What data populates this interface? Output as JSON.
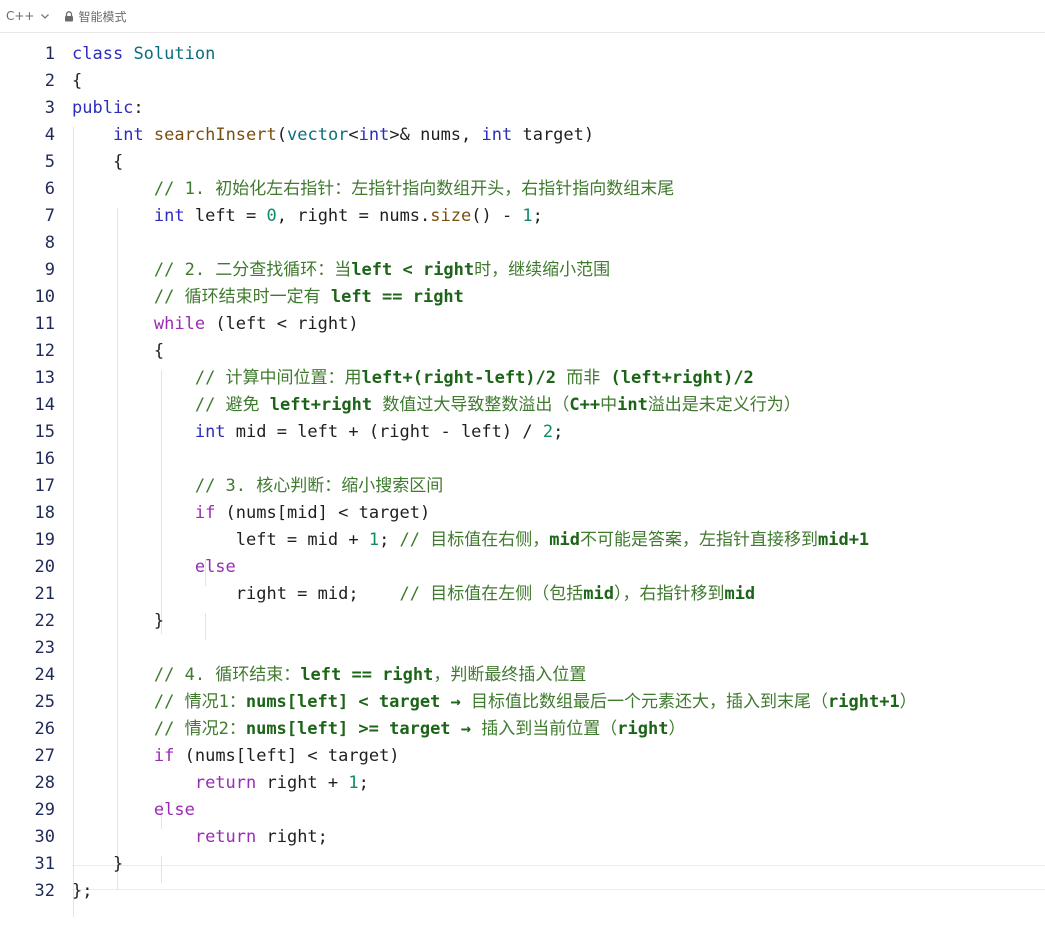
{
  "toolbar": {
    "language": "C++",
    "mode": "智能模式",
    "icons": [
      "chevron-down-icon",
      "lock-icon"
    ]
  },
  "code": {
    "lines": [
      {
        "n": "1",
        "t": [
          {
            "s": "kw",
            "v": "class"
          },
          {
            "s": "",
            "v": " "
          },
          {
            "s": "ty",
            "v": "Solution"
          }
        ]
      },
      {
        "n": "2",
        "t": [
          {
            "s": "",
            "v": "{"
          }
        ]
      },
      {
        "n": "3",
        "t": [
          {
            "s": "kw",
            "v": "public"
          },
          {
            "s": "",
            "v": ":"
          }
        ]
      },
      {
        "n": "4",
        "t": [
          {
            "s": "",
            "v": "    "
          },
          {
            "s": "kw",
            "v": "int"
          },
          {
            "s": "",
            "v": " "
          },
          {
            "s": "fn",
            "v": "searchInsert"
          },
          {
            "s": "",
            "v": "("
          },
          {
            "s": "ty",
            "v": "vector"
          },
          {
            "s": "",
            "v": "<"
          },
          {
            "s": "kw",
            "v": "int"
          },
          {
            "s": "",
            "v": ">& nums, "
          },
          {
            "s": "kw",
            "v": "int"
          },
          {
            "s": "",
            "v": " target)"
          }
        ]
      },
      {
        "n": "5",
        "t": [
          {
            "s": "",
            "v": "    {"
          }
        ]
      },
      {
        "n": "6",
        "t": [
          {
            "s": "",
            "v": "        "
          },
          {
            "s": "cm",
            "v": "// 1. 初始化左右指针：左指针指向数组开头，右指针指向数组末尾"
          }
        ]
      },
      {
        "n": "7",
        "t": [
          {
            "s": "",
            "v": "        "
          },
          {
            "s": "kw",
            "v": "int"
          },
          {
            "s": "",
            "v": " left = "
          },
          {
            "s": "num",
            "v": "0"
          },
          {
            "s": "",
            "v": ", right = nums."
          },
          {
            "s": "fn",
            "v": "size"
          },
          {
            "s": "",
            "v": "() - "
          },
          {
            "s": "num",
            "v": "1"
          },
          {
            "s": "",
            "v": ";"
          }
        ]
      },
      {
        "n": "8",
        "t": []
      },
      {
        "n": "9",
        "t": [
          {
            "s": "",
            "v": "        "
          },
          {
            "s": "cm",
            "v": "// 2. 二分查找循环：当"
          },
          {
            "s": "cmb",
            "v": "left < right"
          },
          {
            "s": "cm",
            "v": "时，继续缩小范围"
          }
        ]
      },
      {
        "n": "10",
        "t": [
          {
            "s": "",
            "v": "        "
          },
          {
            "s": "cm",
            "v": "// 循环结束时一定有 "
          },
          {
            "s": "cmb",
            "v": "left == right"
          }
        ]
      },
      {
        "n": "11",
        "t": [
          {
            "s": "",
            "v": "        "
          },
          {
            "s": "ctl",
            "v": "while"
          },
          {
            "s": "",
            "v": " (left < right)"
          }
        ]
      },
      {
        "n": "12",
        "t": [
          {
            "s": "",
            "v": "        {"
          }
        ]
      },
      {
        "n": "13",
        "t": [
          {
            "s": "",
            "v": "            "
          },
          {
            "s": "cm",
            "v": "// 计算中间位置：用"
          },
          {
            "s": "cmb",
            "v": "left+(right-left)/2"
          },
          {
            "s": "cm",
            "v": " 而非 "
          },
          {
            "s": "cmb",
            "v": "(left+right)/2"
          }
        ]
      },
      {
        "n": "14",
        "t": [
          {
            "s": "",
            "v": "            "
          },
          {
            "s": "cm",
            "v": "// 避免 "
          },
          {
            "s": "cmb",
            "v": "left+right"
          },
          {
            "s": "cm",
            "v": " 数值过大导致整数溢出（"
          },
          {
            "s": "cmb",
            "v": "C++"
          },
          {
            "s": "cm",
            "v": "中"
          },
          {
            "s": "cmb",
            "v": "int"
          },
          {
            "s": "cm",
            "v": "溢出是未定义行为）"
          }
        ]
      },
      {
        "n": "15",
        "t": [
          {
            "s": "",
            "v": "            "
          },
          {
            "s": "kw",
            "v": "int"
          },
          {
            "s": "",
            "v": " mid = left + (right - left) / "
          },
          {
            "s": "num",
            "v": "2"
          },
          {
            "s": "",
            "v": ";"
          }
        ]
      },
      {
        "n": "16",
        "t": []
      },
      {
        "n": "17",
        "t": [
          {
            "s": "",
            "v": "            "
          },
          {
            "s": "cm",
            "v": "// 3. 核心判断：缩小搜索区间"
          }
        ]
      },
      {
        "n": "18",
        "t": [
          {
            "s": "",
            "v": "            "
          },
          {
            "s": "ctl",
            "v": "if"
          },
          {
            "s": "",
            "v": " (nums[mid] < target)"
          }
        ]
      },
      {
        "n": "19",
        "t": [
          {
            "s": "",
            "v": "                left = mid + "
          },
          {
            "s": "num",
            "v": "1"
          },
          {
            "s": "",
            "v": "; "
          },
          {
            "s": "cm",
            "v": "// 目标值在右侧，"
          },
          {
            "s": "cmb",
            "v": "mid"
          },
          {
            "s": "cm",
            "v": "不可能是答案，左指针直接移到"
          },
          {
            "s": "cmb",
            "v": "mid+1"
          }
        ]
      },
      {
        "n": "20",
        "t": [
          {
            "s": "",
            "v": "            "
          },
          {
            "s": "ctl",
            "v": "else"
          }
        ]
      },
      {
        "n": "21",
        "t": [
          {
            "s": "",
            "v": "                right = mid;    "
          },
          {
            "s": "cm",
            "v": "// 目标值在左侧（包括"
          },
          {
            "s": "cmb",
            "v": "mid"
          },
          {
            "s": "cm",
            "v": "），右指针移到"
          },
          {
            "s": "cmb",
            "v": "mid"
          }
        ]
      },
      {
        "n": "22",
        "t": [
          {
            "s": "",
            "v": "        }"
          }
        ]
      },
      {
        "n": "23",
        "t": []
      },
      {
        "n": "24",
        "t": [
          {
            "s": "",
            "v": "        "
          },
          {
            "s": "cm",
            "v": "// 4. 循环结束："
          },
          {
            "s": "cmb",
            "v": "left == right"
          },
          {
            "s": "cm",
            "v": "，判断最终插入位置"
          }
        ]
      },
      {
        "n": "25",
        "t": [
          {
            "s": "",
            "v": "        "
          },
          {
            "s": "cm",
            "v": "// 情况1："
          },
          {
            "s": "cmb",
            "v": "nums[left] < target → "
          },
          {
            "s": "cm",
            "v": "目标值比数组最后一个元素还大，插入到末尾（"
          },
          {
            "s": "cmb",
            "v": "right+1"
          },
          {
            "s": "cm",
            "v": "）"
          }
        ]
      },
      {
        "n": "26",
        "t": [
          {
            "s": "",
            "v": "        "
          },
          {
            "s": "cm",
            "v": "// 情况2："
          },
          {
            "s": "cmb",
            "v": "nums[left] >= target → "
          },
          {
            "s": "cm",
            "v": "插入到当前位置（"
          },
          {
            "s": "cmb",
            "v": "right"
          },
          {
            "s": "cm",
            "v": "）"
          }
        ]
      },
      {
        "n": "27",
        "t": [
          {
            "s": "",
            "v": "        "
          },
          {
            "s": "ctl",
            "v": "if"
          },
          {
            "s": "",
            "v": " (nums[left] < target)"
          }
        ]
      },
      {
        "n": "28",
        "t": [
          {
            "s": "",
            "v": "            "
          },
          {
            "s": "ctl",
            "v": "return"
          },
          {
            "s": "",
            "v": " right + "
          },
          {
            "s": "num",
            "v": "1"
          },
          {
            "s": "",
            "v": ";"
          }
        ]
      },
      {
        "n": "29",
        "t": [
          {
            "s": "",
            "v": "        "
          },
          {
            "s": "ctl",
            "v": "else"
          }
        ]
      },
      {
        "n": "30",
        "t": [
          {
            "s": "",
            "v": "            "
          },
          {
            "s": "ctl",
            "v": "return"
          },
          {
            "s": "",
            "v": " right;"
          }
        ]
      },
      {
        "n": "31",
        "t": [
          {
            "s": "",
            "v": "    }"
          }
        ]
      },
      {
        "n": "32",
        "t": [
          {
            "s": "",
            "v": "};"
          }
        ]
      }
    ]
  }
}
